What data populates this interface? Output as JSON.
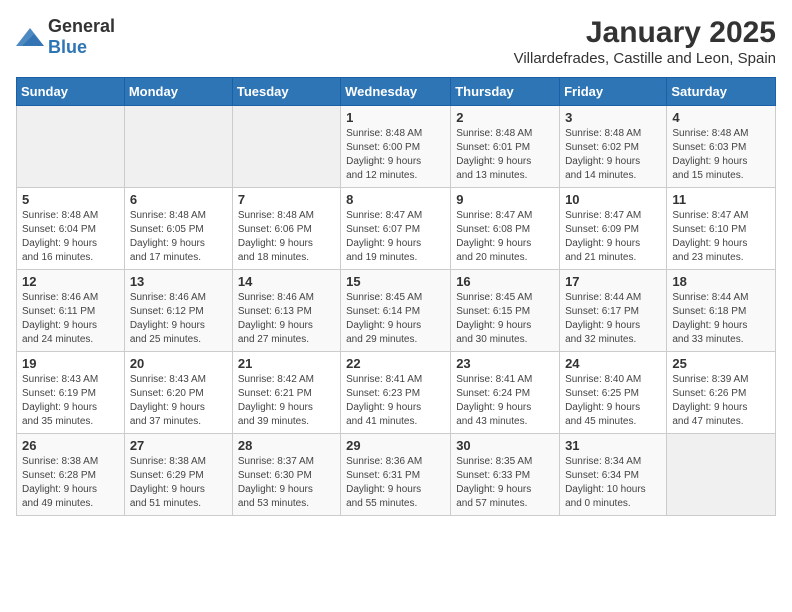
{
  "title": "January 2025",
  "subtitle": "Villardefrades, Castille and Leon, Spain",
  "logo": {
    "general": "General",
    "blue": "Blue"
  },
  "headers": [
    "Sunday",
    "Monday",
    "Tuesday",
    "Wednesday",
    "Thursday",
    "Friday",
    "Saturday"
  ],
  "weeks": [
    [
      {
        "day": "",
        "info": ""
      },
      {
        "day": "",
        "info": ""
      },
      {
        "day": "",
        "info": ""
      },
      {
        "day": "1",
        "info": "Sunrise: 8:48 AM\nSunset: 6:00 PM\nDaylight: 9 hours\nand 12 minutes."
      },
      {
        "day": "2",
        "info": "Sunrise: 8:48 AM\nSunset: 6:01 PM\nDaylight: 9 hours\nand 13 minutes."
      },
      {
        "day": "3",
        "info": "Sunrise: 8:48 AM\nSunset: 6:02 PM\nDaylight: 9 hours\nand 14 minutes."
      },
      {
        "day": "4",
        "info": "Sunrise: 8:48 AM\nSunset: 6:03 PM\nDaylight: 9 hours\nand 15 minutes."
      }
    ],
    [
      {
        "day": "5",
        "info": "Sunrise: 8:48 AM\nSunset: 6:04 PM\nDaylight: 9 hours\nand 16 minutes."
      },
      {
        "day": "6",
        "info": "Sunrise: 8:48 AM\nSunset: 6:05 PM\nDaylight: 9 hours\nand 17 minutes."
      },
      {
        "day": "7",
        "info": "Sunrise: 8:48 AM\nSunset: 6:06 PM\nDaylight: 9 hours\nand 18 minutes."
      },
      {
        "day": "8",
        "info": "Sunrise: 8:47 AM\nSunset: 6:07 PM\nDaylight: 9 hours\nand 19 minutes."
      },
      {
        "day": "9",
        "info": "Sunrise: 8:47 AM\nSunset: 6:08 PM\nDaylight: 9 hours\nand 20 minutes."
      },
      {
        "day": "10",
        "info": "Sunrise: 8:47 AM\nSunset: 6:09 PM\nDaylight: 9 hours\nand 21 minutes."
      },
      {
        "day": "11",
        "info": "Sunrise: 8:47 AM\nSunset: 6:10 PM\nDaylight: 9 hours\nand 23 minutes."
      }
    ],
    [
      {
        "day": "12",
        "info": "Sunrise: 8:46 AM\nSunset: 6:11 PM\nDaylight: 9 hours\nand 24 minutes."
      },
      {
        "day": "13",
        "info": "Sunrise: 8:46 AM\nSunset: 6:12 PM\nDaylight: 9 hours\nand 25 minutes."
      },
      {
        "day": "14",
        "info": "Sunrise: 8:46 AM\nSunset: 6:13 PM\nDaylight: 9 hours\nand 27 minutes."
      },
      {
        "day": "15",
        "info": "Sunrise: 8:45 AM\nSunset: 6:14 PM\nDaylight: 9 hours\nand 29 minutes."
      },
      {
        "day": "16",
        "info": "Sunrise: 8:45 AM\nSunset: 6:15 PM\nDaylight: 9 hours\nand 30 minutes."
      },
      {
        "day": "17",
        "info": "Sunrise: 8:44 AM\nSunset: 6:17 PM\nDaylight: 9 hours\nand 32 minutes."
      },
      {
        "day": "18",
        "info": "Sunrise: 8:44 AM\nSunset: 6:18 PM\nDaylight: 9 hours\nand 33 minutes."
      }
    ],
    [
      {
        "day": "19",
        "info": "Sunrise: 8:43 AM\nSunset: 6:19 PM\nDaylight: 9 hours\nand 35 minutes."
      },
      {
        "day": "20",
        "info": "Sunrise: 8:43 AM\nSunset: 6:20 PM\nDaylight: 9 hours\nand 37 minutes."
      },
      {
        "day": "21",
        "info": "Sunrise: 8:42 AM\nSunset: 6:21 PM\nDaylight: 9 hours\nand 39 minutes."
      },
      {
        "day": "22",
        "info": "Sunrise: 8:41 AM\nSunset: 6:23 PM\nDaylight: 9 hours\nand 41 minutes."
      },
      {
        "day": "23",
        "info": "Sunrise: 8:41 AM\nSunset: 6:24 PM\nDaylight: 9 hours\nand 43 minutes."
      },
      {
        "day": "24",
        "info": "Sunrise: 8:40 AM\nSunset: 6:25 PM\nDaylight: 9 hours\nand 45 minutes."
      },
      {
        "day": "25",
        "info": "Sunrise: 8:39 AM\nSunset: 6:26 PM\nDaylight: 9 hours\nand 47 minutes."
      }
    ],
    [
      {
        "day": "26",
        "info": "Sunrise: 8:38 AM\nSunset: 6:28 PM\nDaylight: 9 hours\nand 49 minutes."
      },
      {
        "day": "27",
        "info": "Sunrise: 8:38 AM\nSunset: 6:29 PM\nDaylight: 9 hours\nand 51 minutes."
      },
      {
        "day": "28",
        "info": "Sunrise: 8:37 AM\nSunset: 6:30 PM\nDaylight: 9 hours\nand 53 minutes."
      },
      {
        "day": "29",
        "info": "Sunrise: 8:36 AM\nSunset: 6:31 PM\nDaylight: 9 hours\nand 55 minutes."
      },
      {
        "day": "30",
        "info": "Sunrise: 8:35 AM\nSunset: 6:33 PM\nDaylight: 9 hours\nand 57 minutes."
      },
      {
        "day": "31",
        "info": "Sunrise: 8:34 AM\nSunset: 6:34 PM\nDaylight: 10 hours\nand 0 minutes."
      },
      {
        "day": "",
        "info": ""
      }
    ]
  ]
}
